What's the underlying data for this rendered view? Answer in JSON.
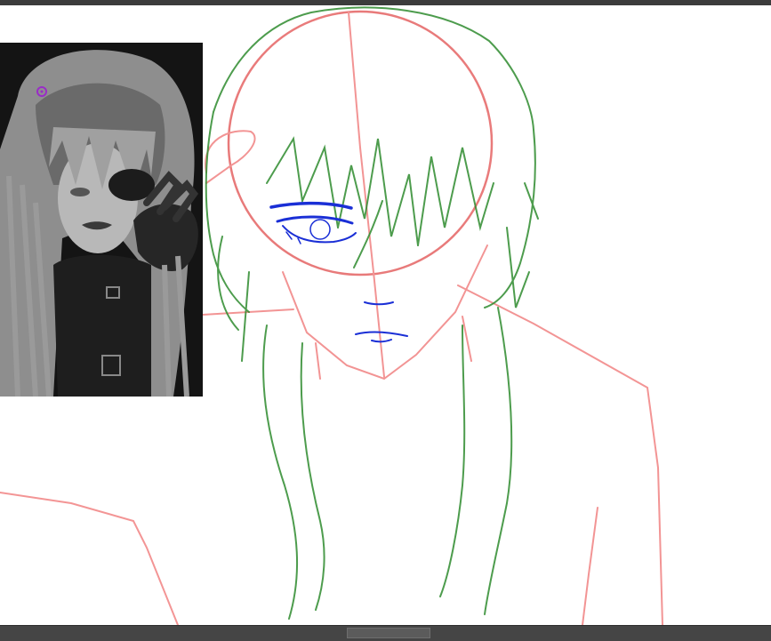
{
  "app": {
    "accent": "#3c3c3c"
  },
  "canvas": {
    "background": "#ffffff",
    "layers": [
      {
        "name": "guides",
        "color": "#f07a7a"
      },
      {
        "name": "hair",
        "color": "#2e8b2e"
      },
      {
        "name": "face-details",
        "color": "#1a2fd6"
      }
    ]
  },
  "reference_image": {
    "subject": "grayscale-portrait",
    "marker_color": "#9a2cc7"
  },
  "scrollbar": {
    "orientation": "horizontal",
    "position": 0.45
  }
}
